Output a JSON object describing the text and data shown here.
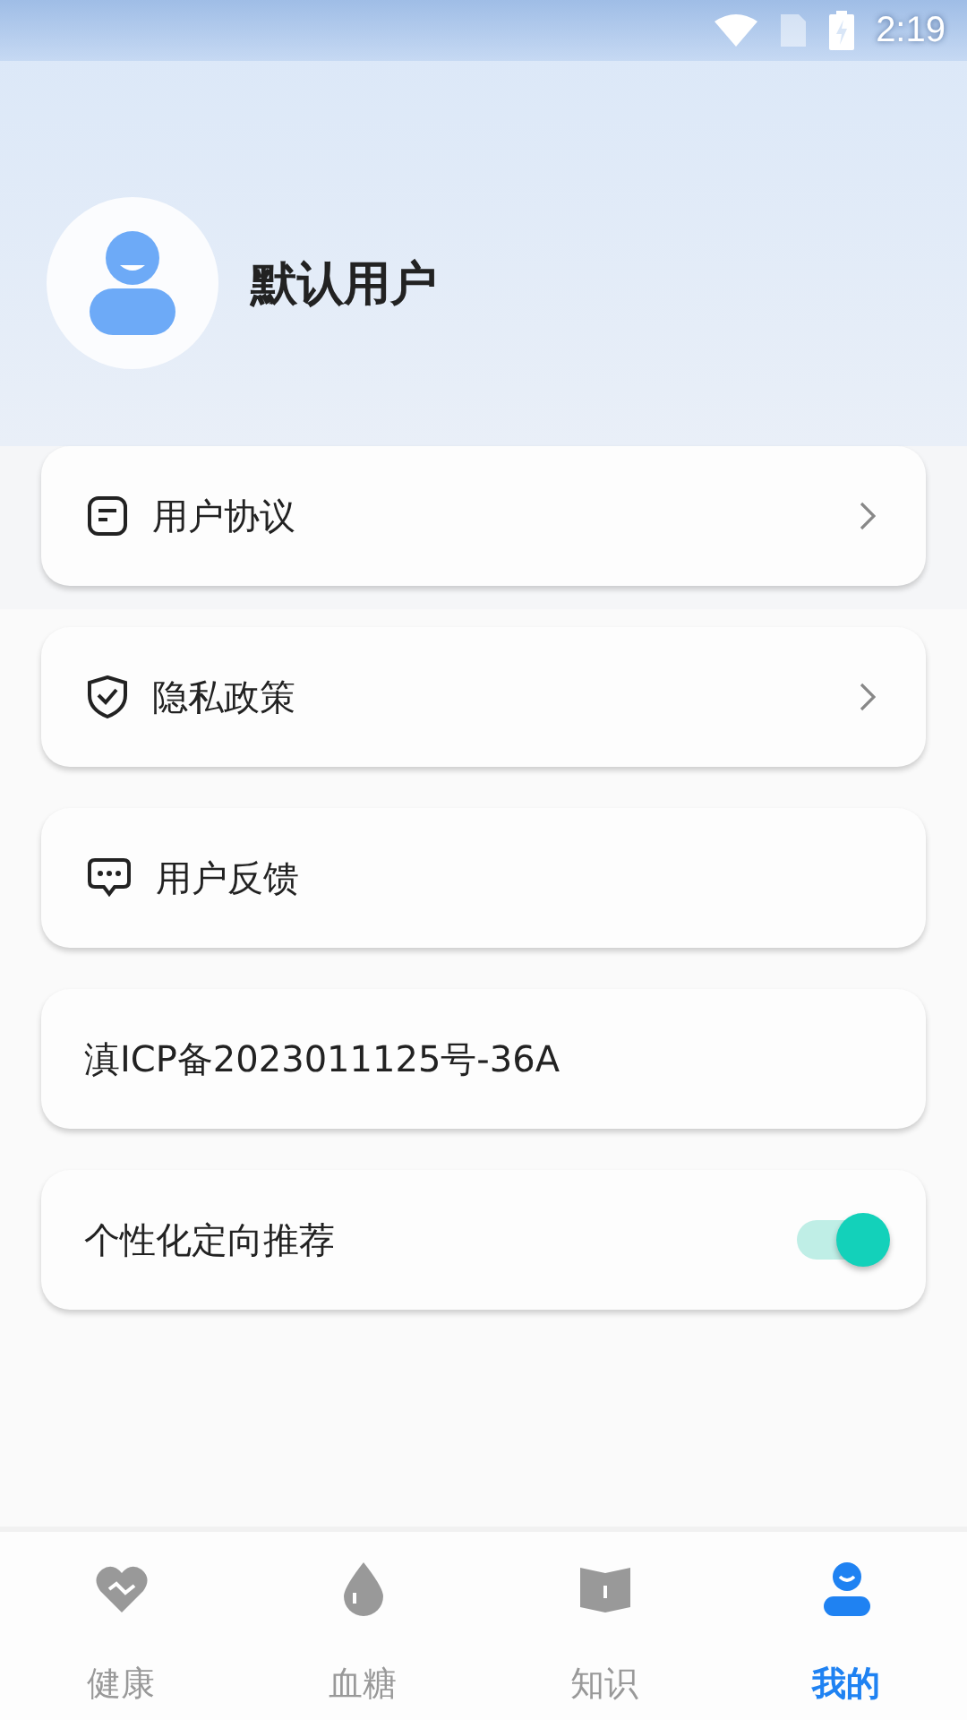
{
  "status_bar": {
    "time": "2:19"
  },
  "profile": {
    "name": "默认用户"
  },
  "menu": [
    {
      "kind": "link",
      "label": "用户协议",
      "chevron": true
    },
    {
      "kind": "link",
      "label": "隐私政策",
      "chevron": true
    },
    {
      "kind": "link",
      "label": "用户反馈",
      "chevron": false
    },
    {
      "kind": "text",
      "label": "滇ICP备2023011125号-36A"
    },
    {
      "kind": "toggle",
      "label": "个性化定向推荐",
      "on": true
    }
  ],
  "tabs": [
    {
      "label": "健康",
      "selected": false
    },
    {
      "label": "血糖",
      "selected": false
    },
    {
      "label": "知识",
      "selected": false
    },
    {
      "label": "我的",
      "selected": true
    }
  ]
}
